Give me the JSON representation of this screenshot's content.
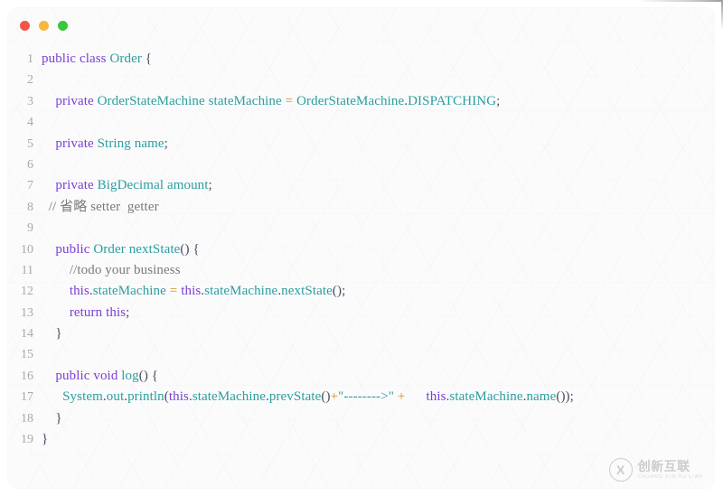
{
  "window": {
    "controls": [
      {
        "name": "close",
        "color": "#f0564a"
      },
      {
        "name": "minimize",
        "color": "#f6b83e"
      },
      {
        "name": "maximize",
        "color": "#3cc63c"
      }
    ]
  },
  "editor": {
    "language": "java",
    "line_count": 19,
    "lines": [
      {
        "number": "1",
        "tokens": [
          {
            "t": "public ",
            "c": "kw"
          },
          {
            "t": "class ",
            "c": "kw"
          },
          {
            "t": "Order",
            "c": "typ"
          },
          {
            "t": " {",
            "c": "pun"
          }
        ]
      },
      {
        "number": "2",
        "tokens": []
      },
      {
        "number": "3",
        "tokens": [
          {
            "t": "    ",
            "c": "pun"
          },
          {
            "t": "private ",
            "c": "kw"
          },
          {
            "t": "OrderStateMachine",
            "c": "typ"
          },
          {
            "t": " ",
            "c": "pun"
          },
          {
            "t": "stateMachine",
            "c": "typ"
          },
          {
            "t": " ",
            "c": "pun"
          },
          {
            "t": "=",
            "c": "op"
          },
          {
            "t": " ",
            "c": "pun"
          },
          {
            "t": "OrderStateMachine",
            "c": "typ"
          },
          {
            "t": ".",
            "c": "pun"
          },
          {
            "t": "DISPATCHING",
            "c": "typ"
          },
          {
            "t": ";",
            "c": "pun"
          }
        ]
      },
      {
        "number": "4",
        "tokens": []
      },
      {
        "number": "5",
        "tokens": [
          {
            "t": "    ",
            "c": "pun"
          },
          {
            "t": "private ",
            "c": "kw"
          },
          {
            "t": "String",
            "c": "typ"
          },
          {
            "t": " ",
            "c": "pun"
          },
          {
            "t": "name",
            "c": "typ"
          },
          {
            "t": ";",
            "c": "pun"
          }
        ]
      },
      {
        "number": "6",
        "tokens": []
      },
      {
        "number": "7",
        "tokens": [
          {
            "t": "    ",
            "c": "pun"
          },
          {
            "t": "private ",
            "c": "kw"
          },
          {
            "t": "BigDecimal",
            "c": "typ"
          },
          {
            "t": " ",
            "c": "pun"
          },
          {
            "t": "amount",
            "c": "typ"
          },
          {
            "t": ";",
            "c": "pun"
          }
        ]
      },
      {
        "number": "8",
        "tokens": [
          {
            "t": "  ",
            "c": "pun"
          },
          {
            "t": "// 省略 setter  getter",
            "c": "cmt"
          }
        ]
      },
      {
        "number": "9",
        "tokens": []
      },
      {
        "number": "10",
        "tokens": [
          {
            "t": "    ",
            "c": "pun"
          },
          {
            "t": "public ",
            "c": "kw"
          },
          {
            "t": "Order",
            "c": "typ"
          },
          {
            "t": " ",
            "c": "pun"
          },
          {
            "t": "nextState",
            "c": "typ"
          },
          {
            "t": "() {",
            "c": "pun"
          }
        ]
      },
      {
        "number": "11",
        "tokens": [
          {
            "t": "        ",
            "c": "pun"
          },
          {
            "t": "//todo your business",
            "c": "cmt"
          }
        ]
      },
      {
        "number": "12",
        "tokens": [
          {
            "t": "        ",
            "c": "pun"
          },
          {
            "t": "this",
            "c": "kw"
          },
          {
            "t": ".",
            "c": "pun"
          },
          {
            "t": "stateMachine",
            "c": "typ"
          },
          {
            "t": " ",
            "c": "pun"
          },
          {
            "t": "=",
            "c": "op"
          },
          {
            "t": " ",
            "c": "pun"
          },
          {
            "t": "this",
            "c": "kw"
          },
          {
            "t": ".",
            "c": "pun"
          },
          {
            "t": "stateMachine",
            "c": "typ"
          },
          {
            "t": ".",
            "c": "pun"
          },
          {
            "t": "nextState",
            "c": "typ"
          },
          {
            "t": "();",
            "c": "pun"
          }
        ]
      },
      {
        "number": "13",
        "tokens": [
          {
            "t": "        ",
            "c": "pun"
          },
          {
            "t": "return ",
            "c": "kw"
          },
          {
            "t": "this",
            "c": "kw"
          },
          {
            "t": ";",
            "c": "pun"
          }
        ]
      },
      {
        "number": "14",
        "tokens": [
          {
            "t": "    }",
            "c": "pun"
          }
        ]
      },
      {
        "number": "15",
        "tokens": []
      },
      {
        "number": "16",
        "tokens": [
          {
            "t": "    ",
            "c": "pun"
          },
          {
            "t": "public ",
            "c": "kw"
          },
          {
            "t": "void ",
            "c": "kw"
          },
          {
            "t": "log",
            "c": "typ"
          },
          {
            "t": "() {",
            "c": "pun"
          }
        ]
      },
      {
        "number": "17",
        "tokens": [
          {
            "t": "      ",
            "c": "pun"
          },
          {
            "t": "System",
            "c": "typ"
          },
          {
            "t": ".",
            "c": "pun"
          },
          {
            "t": "out",
            "c": "typ"
          },
          {
            "t": ".",
            "c": "pun"
          },
          {
            "t": "println",
            "c": "typ"
          },
          {
            "t": "(",
            "c": "pun"
          },
          {
            "t": "this",
            "c": "kw"
          },
          {
            "t": ".",
            "c": "pun"
          },
          {
            "t": "stateMachine",
            "c": "typ"
          },
          {
            "t": ".",
            "c": "pun"
          },
          {
            "t": "prevState",
            "c": "typ"
          },
          {
            "t": "()",
            "c": "pun"
          },
          {
            "t": "+",
            "c": "op"
          },
          {
            "t": "\"-------->\"",
            "c": "str"
          },
          {
            "t": " ",
            "c": "pun"
          },
          {
            "t": "+",
            "c": "op"
          },
          {
            "t": "      ",
            "c": "pun"
          },
          {
            "t": "this",
            "c": "kw"
          },
          {
            "t": ".",
            "c": "pun"
          },
          {
            "t": "stateMachine",
            "c": "typ"
          },
          {
            "t": ".",
            "c": "pun"
          },
          {
            "t": "name",
            "c": "typ"
          },
          {
            "t": "());",
            "c": "pun"
          }
        ]
      },
      {
        "number": "18",
        "tokens": [
          {
            "t": "    }",
            "c": "pun"
          }
        ]
      },
      {
        "number": "19",
        "tokens": [
          {
            "t": "}",
            "c": "pun"
          }
        ]
      }
    ]
  },
  "watermark": {
    "logo_letter": "X",
    "brand_cn": "创新互联",
    "brand_pinyin": "CHUANG XIN HU LIAN"
  },
  "colors": {
    "keyword": "#7c3fd4",
    "type": "#2b9e9e",
    "operator": "#d98b22",
    "comment": "#7a7a7a",
    "punctuation": "#4b4b63",
    "line_number": "#a9a9a9",
    "background": "#fbfbfc"
  }
}
